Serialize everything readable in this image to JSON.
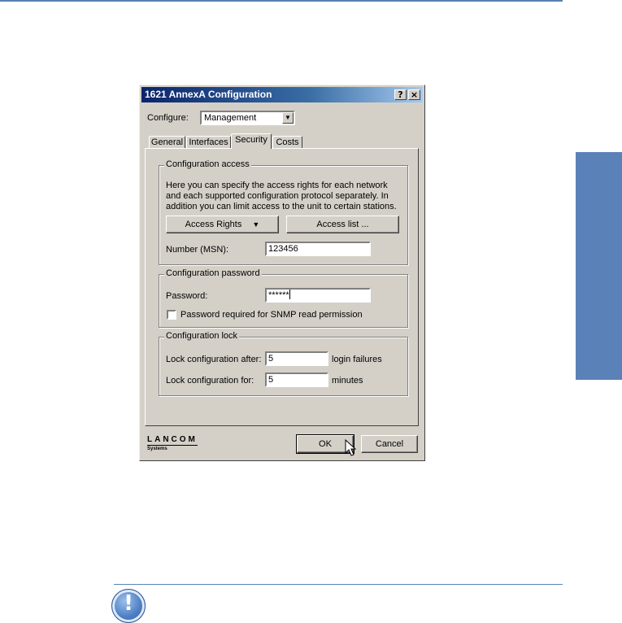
{
  "window": {
    "title": "1621 AnnexA Configuration",
    "help_glyph": "?",
    "close_glyph": "×"
  },
  "configure": {
    "label": "Configure:",
    "selected": "Management"
  },
  "tabs": [
    {
      "label": "General",
      "active": false
    },
    {
      "label": "Interfaces",
      "active": false
    },
    {
      "label": "Security",
      "active": true
    },
    {
      "label": "Costs",
      "active": false
    }
  ],
  "config_access": {
    "legend": "Configuration access",
    "description": "Here you can specify the access rights for each network and each supported configuration protocol separately. In addition you can limit access to the unit to certain stations.",
    "access_rights_label": "Access Rights",
    "access_list_label": "Access list ...",
    "msn_label": "Number (MSN):",
    "msn_value": "123456"
  },
  "config_password": {
    "legend": "Configuration password",
    "password_label": "Password:",
    "password_value": "******",
    "snmp_checkbox_label": "Password required for SNMP read permission",
    "snmp_checked": false
  },
  "config_lock": {
    "legend": "Configuration lock",
    "lock_after_label": "Lock configuration after:",
    "lock_after_value": "5",
    "lock_after_unit": "login failures",
    "lock_for_label": "Lock configuration for:",
    "lock_for_value": "5",
    "lock_for_unit": "minutes"
  },
  "footer": {
    "logo_main": "LANCOM",
    "logo_sub": "Systems",
    "ok_label": "OK",
    "cancel_label": "Cancel"
  },
  "page": {
    "note_icon_glyph": "!"
  },
  "colors": {
    "accent": "#5b82b8",
    "title_bar": "#0a246a",
    "dialog_face": "#d4d0c8"
  }
}
